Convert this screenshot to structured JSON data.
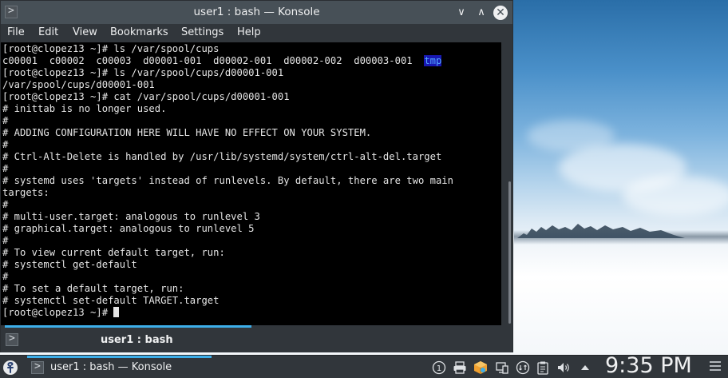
{
  "window": {
    "title": "user1 : bash — Konsole",
    "app_icon_glyph": ">",
    "controls": {
      "minimize": "∨",
      "maximize": "∧",
      "close": "✕"
    }
  },
  "menubar": {
    "items": [
      "File",
      "Edit",
      "View",
      "Bookmarks",
      "Settings",
      "Help"
    ]
  },
  "terminal": {
    "lines": [
      "[root@clopez13 ~]# ls /var/spool/cups",
      "c00001  c00002  c00003  d00001-001  d00002-001  d00002-002  d00003-001  ",
      "[root@clopez13 ~]# ls /var/spool/cups/d00001-001",
      "/var/spool/cups/d00001-001",
      "[root@clopez13 ~]# cat /var/spool/cups/d00001-001",
      "# inittab is no longer used.",
      "#",
      "# ADDING CONFIGURATION HERE WILL HAVE NO EFFECT ON YOUR SYSTEM.",
      "#",
      "# Ctrl-Alt-Delete is handled by /usr/lib/systemd/system/ctrl-alt-del.target",
      "#",
      "# systemd uses 'targets' instead of runlevels. By default, there are two main",
      "targets:",
      "#",
      "# multi-user.target: analogous to runlevel 3",
      "# graphical.target: analogous to runlevel 5",
      "#",
      "# To view current default target, run:",
      "# systemctl get-default",
      "#",
      "# To set a default target, run:",
      "# systemctl set-default TARGET.target",
      "[root@clopez13 ~]# "
    ],
    "highlighted_entry": "tmp",
    "colors": {
      "background": "#000000",
      "foreground": "#e5e5e5",
      "dir_highlight_bg": "#1818b2",
      "dir_highlight_fg": "#54a8ff"
    }
  },
  "tabbar": {
    "new_tab_glyph": ">",
    "active_tab_label": "user1 : bash"
  },
  "taskbar": {
    "task_label": "user1 : bash — Konsole",
    "task_icon_glyph": ">",
    "clock": "9:35 PM",
    "tray": {
      "notifications_badge": "1",
      "icons": [
        "notifications-icon",
        "printer-icon",
        "package-icon",
        "display-icon",
        "network-icon",
        "clipboard-icon",
        "volume-icon",
        "expand-tray-icon"
      ]
    },
    "accent_color": "#3daee9"
  }
}
